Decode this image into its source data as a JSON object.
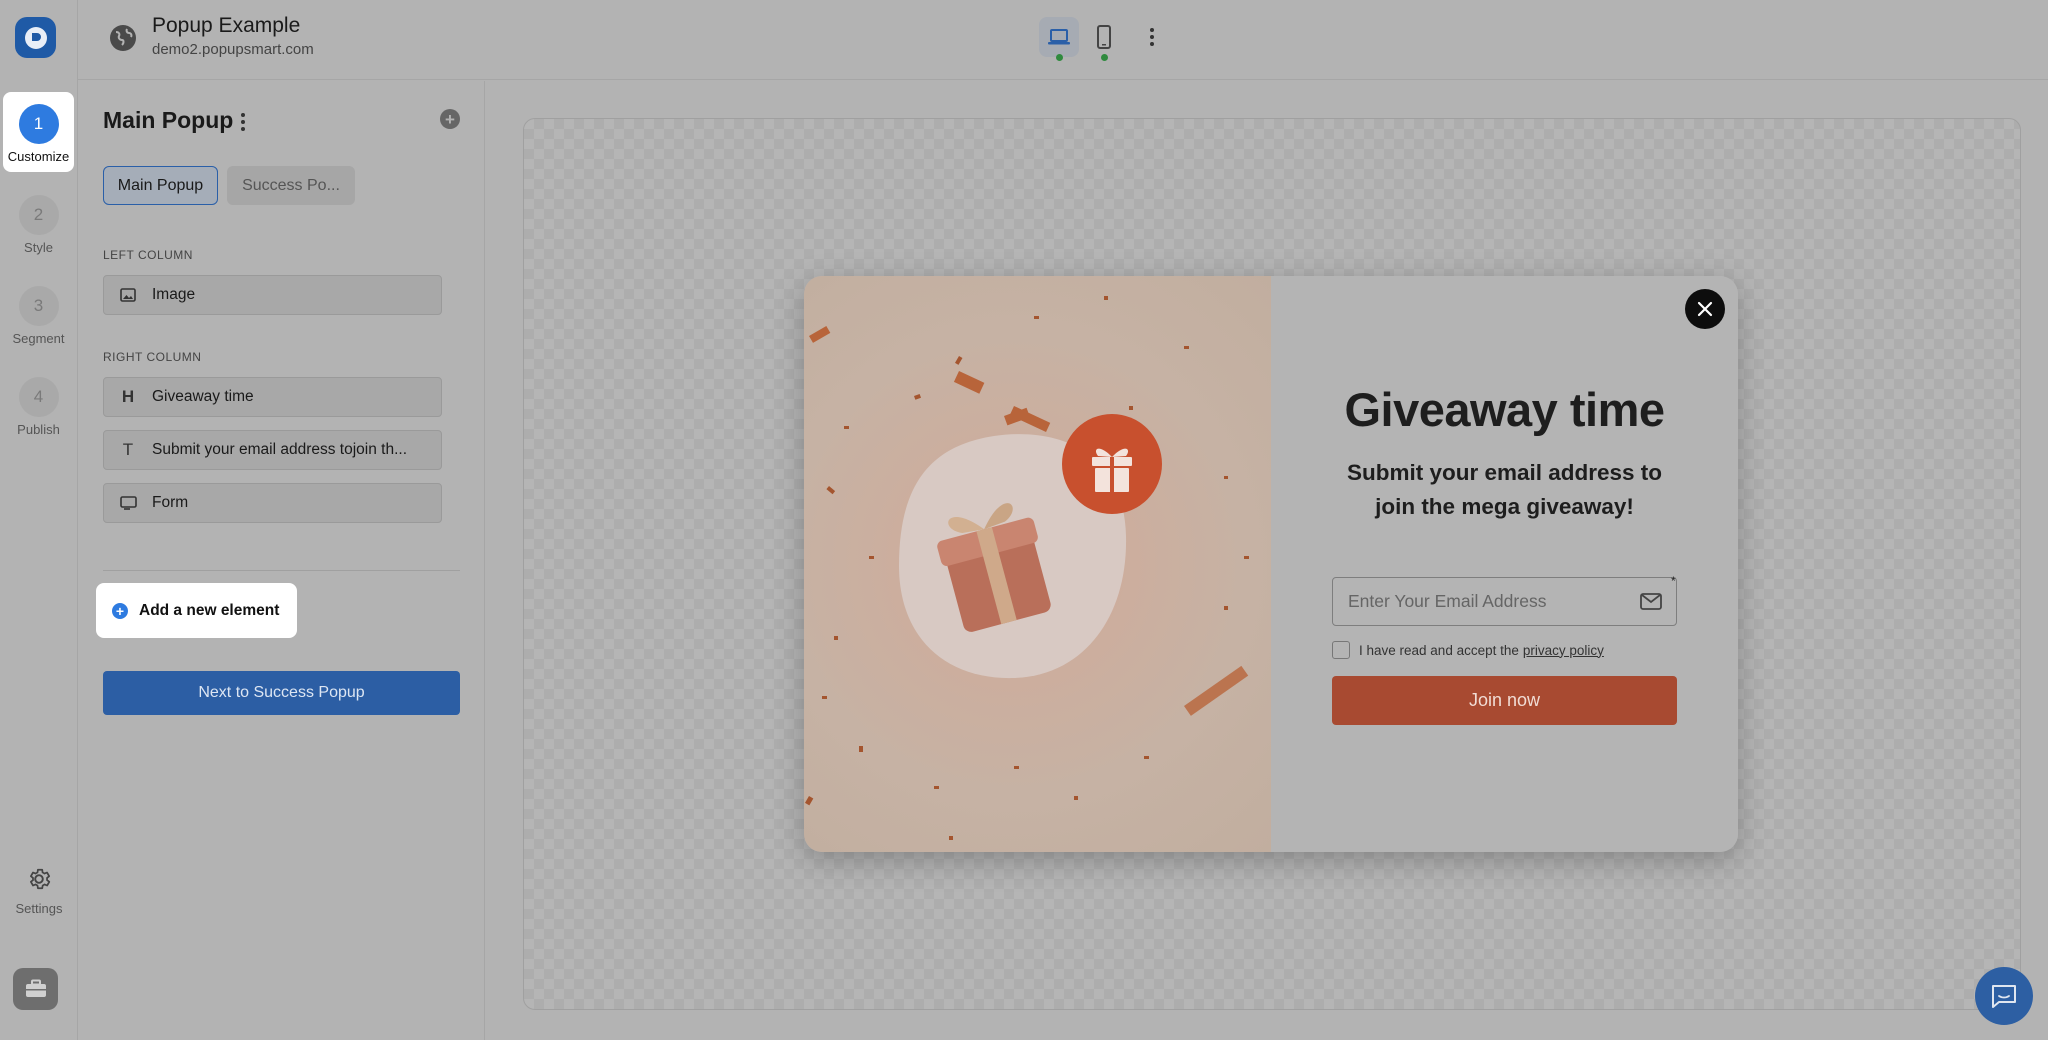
{
  "header": {
    "title": "Popup Example",
    "url": "demo2.popupsmart.com"
  },
  "steps": [
    {
      "num": "1",
      "label": "Customize"
    },
    {
      "num": "2",
      "label": "Style"
    },
    {
      "num": "3",
      "label": "Segment"
    },
    {
      "num": "4",
      "label": "Publish"
    }
  ],
  "rail": {
    "settings_label": "Settings"
  },
  "panel": {
    "title": "Main Popup",
    "tabs": [
      "Main Popup",
      "Success Po..."
    ],
    "left_column_label": "LEFT COLUMN",
    "right_column_label": "RIGHT COLUMN",
    "left_items": [
      {
        "icon": "image-icon",
        "label": "Image"
      }
    ],
    "right_items": [
      {
        "icon": "heading-icon",
        "label": "Giveaway time"
      },
      {
        "icon": "text-icon",
        "label": "Submit your email address tojoin th..."
      },
      {
        "icon": "form-icon",
        "label": "Form"
      }
    ],
    "add_element_label": "Add a new element",
    "next_button_label": "Next to Success Popup"
  },
  "popup": {
    "headline": "Giveaway time",
    "subhead": "Submit your email address to join the mega giveaway!",
    "email_placeholder": "Enter Your Email Address",
    "required_mark": "*",
    "consent_text": "I have read and accept the",
    "consent_link": "privacy policy",
    "join_button": "Join now"
  },
  "colors": {
    "accent_blue": "#2e7be0",
    "primary_button": "#2c5ea4",
    "join_button": "#a84a31",
    "gift_badge": "#c8502e",
    "device_indicator": "#2f8a3e"
  }
}
